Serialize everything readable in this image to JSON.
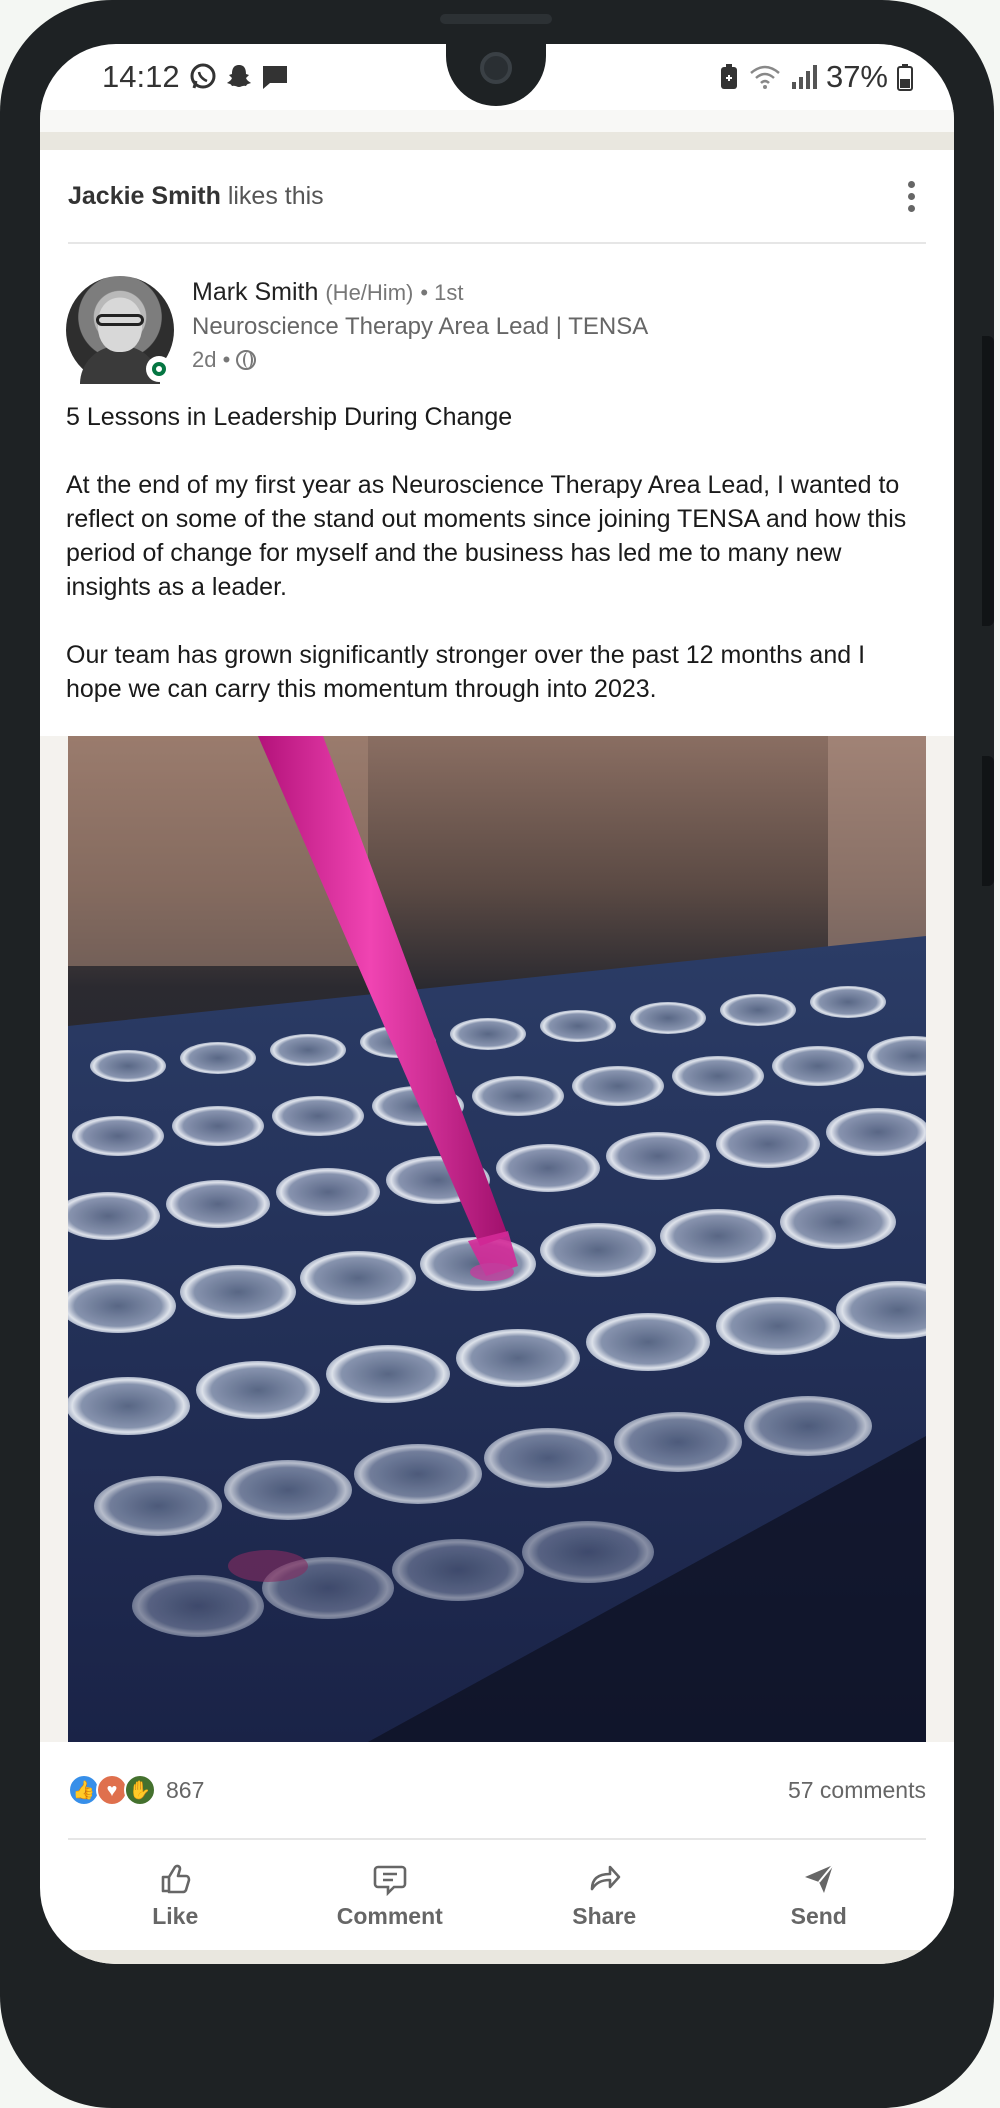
{
  "status_bar": {
    "time": "14:12",
    "battery_percent": "37%"
  },
  "feed_item": {
    "social_context": {
      "actor": "Jackie Smith",
      "action": "likes this"
    },
    "author": {
      "name": "Mark Smith",
      "pronouns": "(He/Him)",
      "connection": "• 1st",
      "headline": "Neuroscience Therapy Area Lead | TENSA",
      "time_ago": "2d •"
    },
    "post": {
      "title": "5 Lessons in Leadership During Change",
      "paragraph_1": "At the end of my first year as Neuroscience Therapy Area Lead, I wanted to reflect on some of the stand out moments since joining TENSA and how this period of change for myself and the business has led me to many new insights as a leader.",
      "paragraph_2": "Our team has grown significantly stronger over the past 12 months and I hope we can carry this momentum through into 2023."
    },
    "social_counts": {
      "reactions": "867",
      "comments": "57 comments"
    },
    "actions": {
      "like": "Like",
      "comment": "Comment",
      "share": "Share",
      "send": "Send"
    }
  },
  "colors": {
    "online_green": "#057642",
    "like_blue": "#378fe9",
    "love_red": "#df704d",
    "celebrate_green": "#44712e",
    "pipette_magenta": "#e0199a"
  },
  "icons": [
    "whatsapp-icon",
    "snapchat-icon",
    "message-icon",
    "battery-saver-icon",
    "wifi-icon",
    "signal-icon",
    "battery-icon",
    "more-vertical-icon",
    "globe-icon",
    "like-icon",
    "comment-icon",
    "share-icon",
    "send-icon"
  ]
}
